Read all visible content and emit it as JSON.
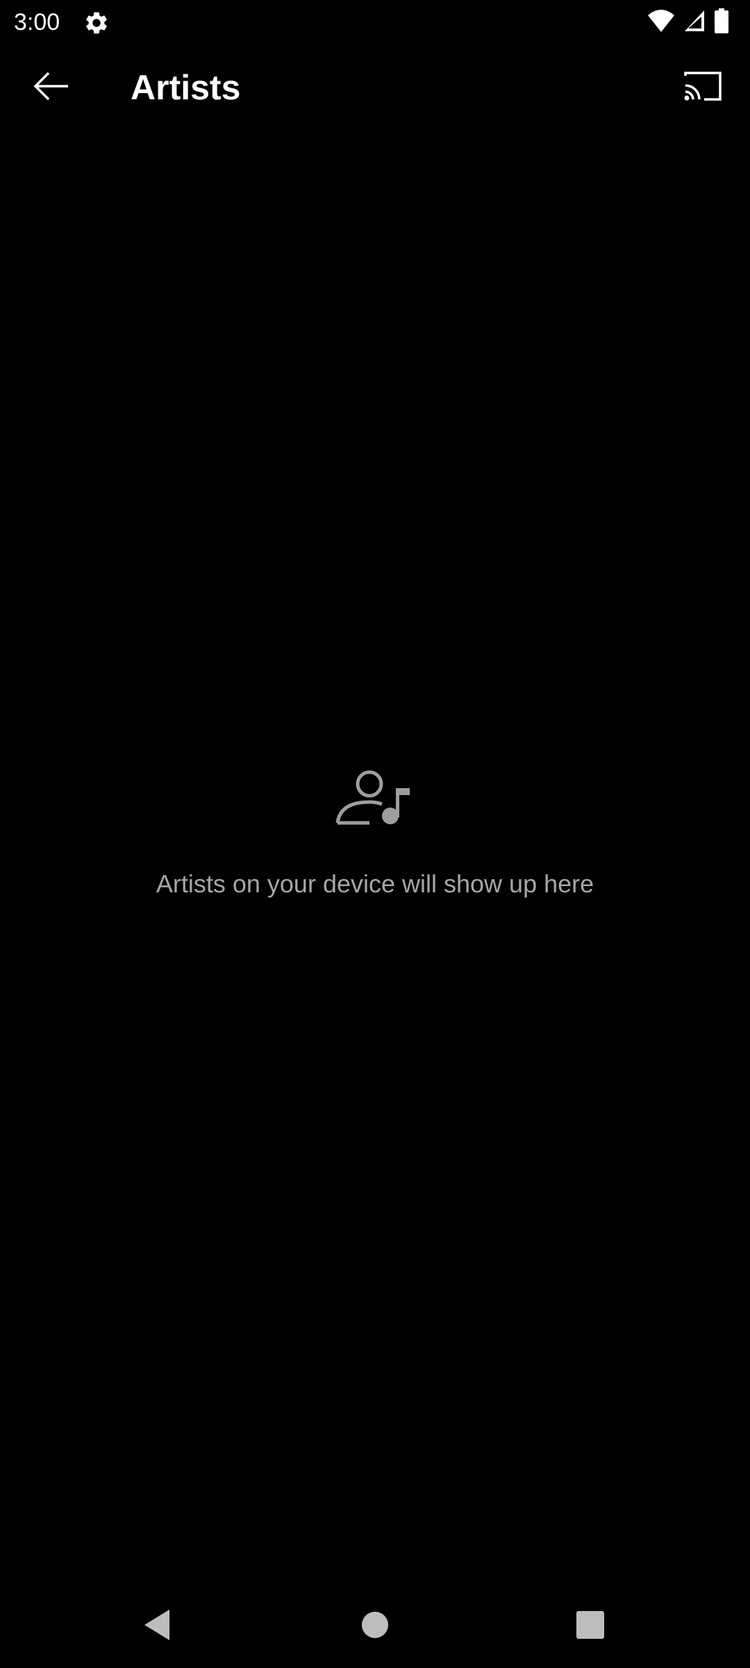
{
  "status_bar": {
    "time": "3:00",
    "icons": [
      "settings-gear-icon",
      "wifi-icon",
      "cellular-signal-icon",
      "battery-icon"
    ]
  },
  "app_bar": {
    "title": "Artists",
    "back_icon": "arrow-back-icon",
    "cast_icon": "cast-icon"
  },
  "empty_state": {
    "icon": "artist-music-icon",
    "message": "Artists on your device will show up here"
  },
  "nav_bar": {
    "icons": [
      "back-triangle-icon",
      "home-circle-icon",
      "recents-square-icon"
    ]
  },
  "colors": {
    "background": "#000000",
    "title_text": "#ffffff",
    "secondary_text": "#a6a6a6",
    "icon_gray": "#9e9e9e",
    "nav_gray": "#bdbdbd"
  }
}
